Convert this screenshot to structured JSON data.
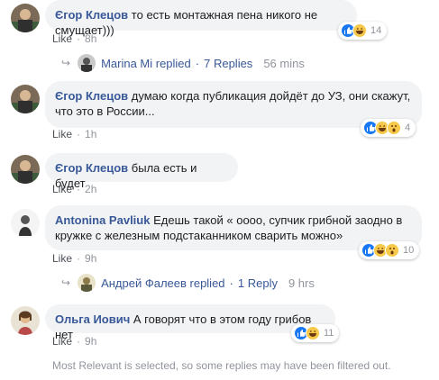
{
  "comments": [
    {
      "author": "Єгор Клецов",
      "text": "то есть монтажная пена никого не смущает)))",
      "like": "Like",
      "time": "8h",
      "reaction_count": "14",
      "reactions": [
        "like",
        "haha"
      ]
    },
    {
      "author": "Єгор Клецов",
      "text": "думаю когда публикация дойдёт до УЗ, они скажут, что это в России...",
      "like": "Like",
      "time": "1h",
      "reaction_count": "4",
      "reactions": [
        "like",
        "haha",
        "wow"
      ]
    },
    {
      "author": "Єгор Клецов",
      "text": "была есть и будет",
      "like": "Like",
      "time": "2h"
    },
    {
      "author": "Antonina Pavliuk",
      "text": "Едешь такой « оооо, супчик грибной заодно в кружке с железным подстаканником сварить можно»",
      "like": "Like",
      "time": "9h",
      "reaction_count": "10",
      "reactions": [
        "like",
        "haha",
        "wow"
      ]
    },
    {
      "author": "Ольга Иович",
      "text": "А говорят что в этом году грибов нет",
      "like": "Like",
      "time": "9h",
      "reaction_count": "11",
      "reactions": [
        "like",
        "haha"
      ]
    }
  ],
  "reply_threads": [
    {
      "name": "Marina Mi replied",
      "dot": "·",
      "count": "7 Replies",
      "time": "56 mins"
    },
    {
      "name": "Андрей Фалеев replied",
      "dot": "·",
      "count": "1 Reply",
      "time": "9 hrs"
    }
  ],
  "footer": "Most Relevant is selected, so some replies may have been filtered out.",
  "colors": {
    "author": "#385898",
    "bubble": "#f2f3f5",
    "meta": "#90949c",
    "like_blue": "#1877f2"
  }
}
